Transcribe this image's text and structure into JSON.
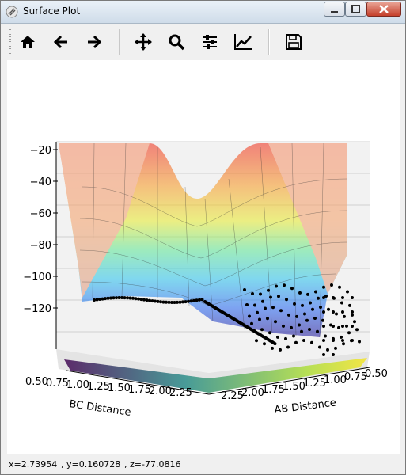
{
  "window": {
    "title": "Surface Plot"
  },
  "toolbar": {
    "buttons": [
      {
        "name": "home",
        "icon": "home-icon"
      },
      {
        "name": "back",
        "icon": "arrow-left-icon"
      },
      {
        "name": "forward",
        "icon": "arrow-right-icon"
      },
      {
        "name": "pan",
        "icon": "move-icon"
      },
      {
        "name": "zoom",
        "icon": "magnifier-icon"
      },
      {
        "name": "configure-subplots",
        "icon": "sliders-icon"
      },
      {
        "name": "edit-axis",
        "icon": "line-chart-icon"
      },
      {
        "name": "save",
        "icon": "floppy-disk-icon"
      }
    ]
  },
  "chart_data": {
    "type": "surface3d",
    "zticks": [
      "−20",
      "−40",
      "−60",
      "−80",
      "−100",
      "−120"
    ],
    "bc_ticks": [
      "0.50",
      "0.75",
      "1.00",
      "1.25",
      "1.50",
      "1.75",
      "2.00",
      "2.25"
    ],
    "ab_ticks": [
      "2.25",
      "2.00",
      "1.75",
      "1.50",
      "1.25",
      "1.00",
      "0.75",
      "0.50"
    ],
    "xlabel": "BC Distance",
    "ylabel": "AB Distance",
    "colormap": "jet",
    "trajectory_color": "#000000"
  },
  "status": {
    "x": "x=2.73954",
    "y": ", y=0.160728",
    "z": ", z=-77.0816"
  }
}
